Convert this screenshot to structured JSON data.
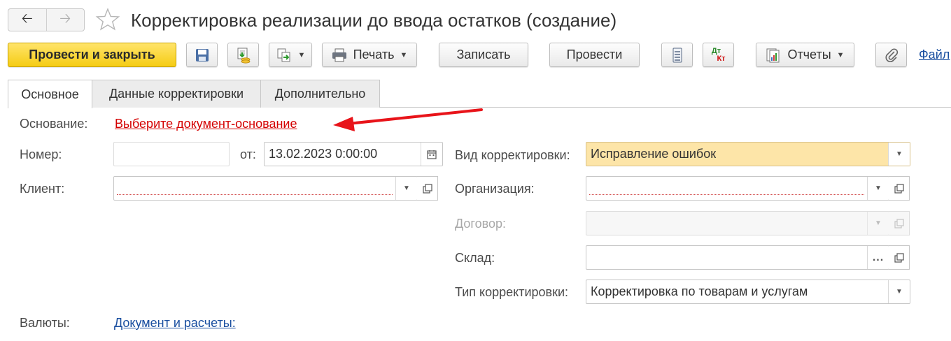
{
  "window": {
    "title": "Корректировка реализации до ввода остатков (создание)"
  },
  "toolbar": {
    "post_and_close": "Провести и закрыть",
    "print": "Печать",
    "write": "Записать",
    "post": "Провести",
    "dt_label": "Дт",
    "kt_label": "Кт",
    "reports": "Отчеты",
    "files": "Файл"
  },
  "tabs": [
    {
      "label": "Основное"
    },
    {
      "label": "Данные корректировки"
    },
    {
      "label": "Дополнительно"
    }
  ],
  "form": {
    "basis_label": "Основание:",
    "basis_link": "Выберите документ-основание",
    "number_label": "Номер:",
    "number_value": "",
    "from_label": "от:",
    "date_value": "13.02.2023  0:00:00",
    "client_label": "Клиент:",
    "client_value": "",
    "correction_kind_label": "Вид корректировки:",
    "correction_kind_value": "Исправление ошибок",
    "organization_label": "Организация:",
    "organization_value": "",
    "contract_label": "Договор:",
    "contract_value": "",
    "warehouse_label": "Склад:",
    "warehouse_value": "",
    "warehouse_select": "...",
    "correction_type_label": "Тип корректировки:",
    "correction_type_value": "Корректировка по товарам и услугам",
    "currencies_label": "Валюты:",
    "currencies_link": "Документ и расчеты:"
  },
  "colors": {
    "primary_button": "#f5cc14",
    "highlight_field": "#fde5a8",
    "link_red": "#d40000",
    "link_blue": "#1a4fa0",
    "annotation_arrow": "#e8141a"
  }
}
